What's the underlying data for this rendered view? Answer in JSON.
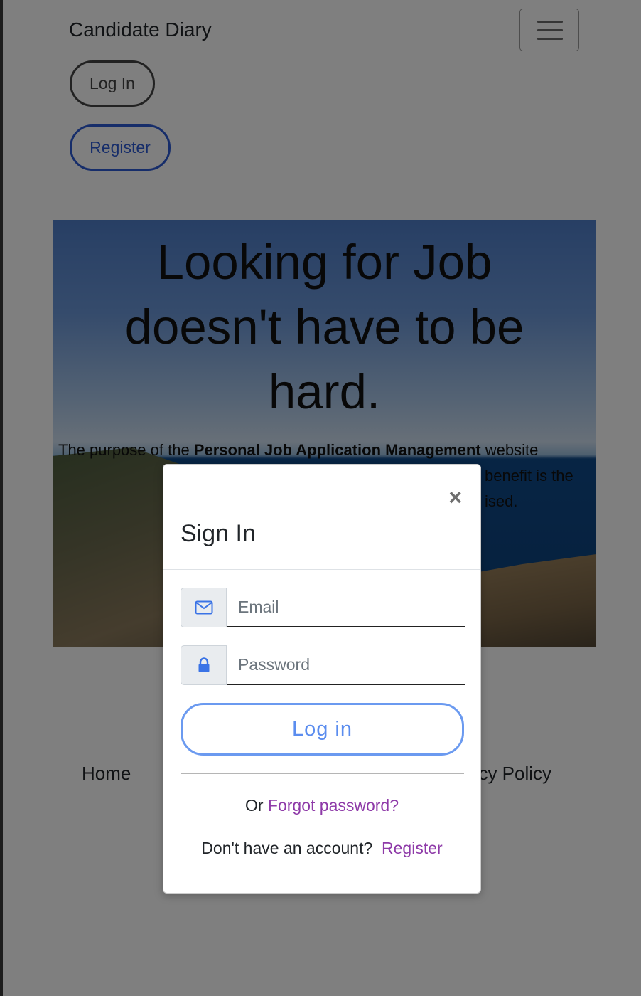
{
  "navbar": {
    "brand": "Candidate Diary",
    "login_label": "Log In",
    "register_label": "Register"
  },
  "hero": {
    "title_line1": "Looking for Job",
    "title_line2": "doesn't have to be",
    "title_line3": "hard.",
    "text_prefix": "The purpose of the ",
    "text_bold": "Personal Job Application Management",
    "text_suffix": " website",
    "text_fragment2": "benefit is the",
    "text_fragment3": "ised."
  },
  "footer": {
    "home_label": "Home",
    "privacy_label_visible": "acy Policy"
  },
  "modal": {
    "close_glyph": "×",
    "title": "Sign In",
    "email_placeholder": "Email",
    "password_placeholder": "Password",
    "login_button": "Log in",
    "or_text": "Or ",
    "forgot_link": "Forgot password?",
    "no_account_text": "Don't have an account? ",
    "register_link": "Register"
  },
  "icons": {
    "email": "envelope-icon",
    "password": "lock-icon",
    "menu": "hamburger-menu-icon"
  },
  "colors": {
    "accent_blue": "#5b8def",
    "link_purple": "#8e3aa8",
    "register_outline": "#2d5bd4"
  }
}
